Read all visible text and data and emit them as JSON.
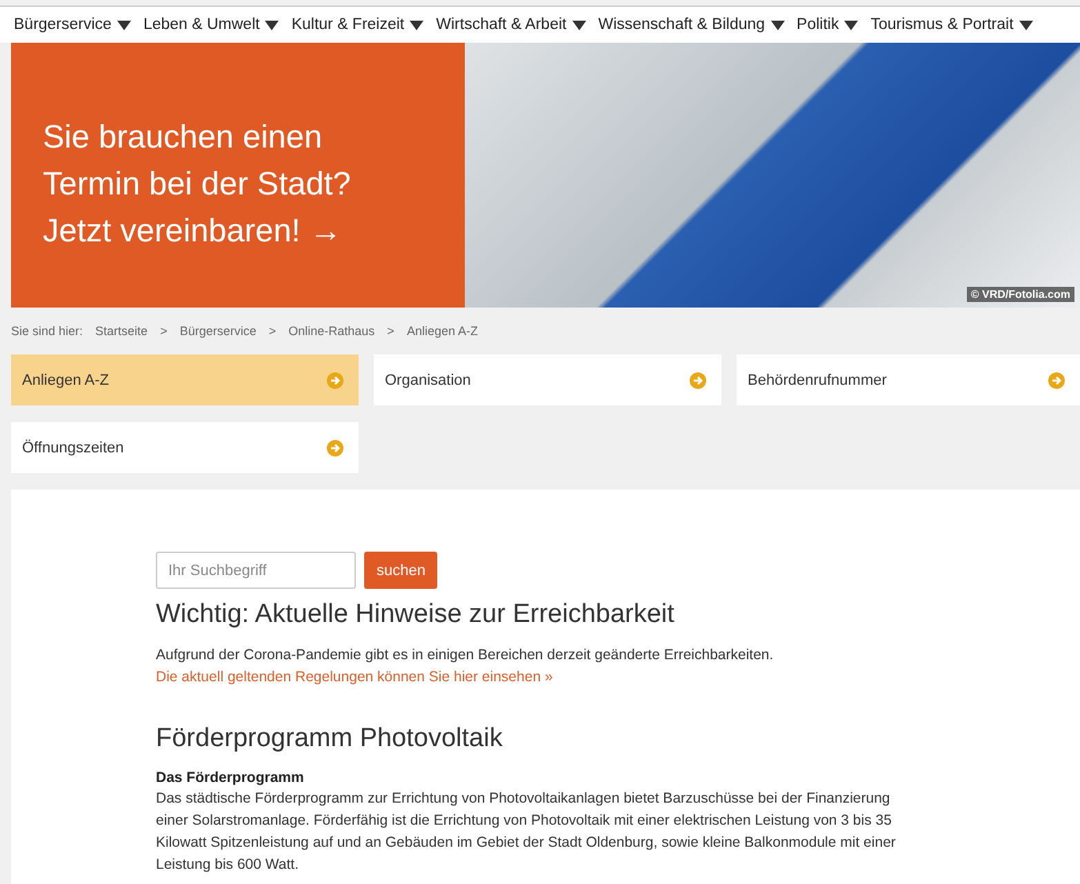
{
  "nav": {
    "items": [
      {
        "label": "Bürgerservice"
      },
      {
        "label": "Leben & Umwelt"
      },
      {
        "label": "Kultur & Freizeit"
      },
      {
        "label": "Wirtschaft & Arbeit"
      },
      {
        "label": "Wissenschaft & Bildung"
      },
      {
        "label": "Politik"
      },
      {
        "label": "Tourismus & Portrait"
      }
    ]
  },
  "hero": {
    "lines": [
      "Sie brauchen einen",
      "Termin bei der Stadt?",
      "Jetzt vereinbaren! →"
    ],
    "credit": "© VRD/Fotolia.com"
  },
  "breadcrumb": {
    "label": "Sie sind hier:",
    "items": [
      "Startseite",
      "Bürgerservice",
      "Online-Rathaus",
      "Anliegen A-Z"
    ],
    "separators": [
      ">",
      ">",
      ">"
    ]
  },
  "tiles": [
    {
      "label": "Anliegen A-Z",
      "selected": true
    },
    {
      "label": "Organisation",
      "selected": false
    },
    {
      "label": "Behördenrufnummer",
      "selected": false
    },
    {
      "label": "Öffnungszeiten",
      "selected": false
    }
  ],
  "search": {
    "placeholder": "Ihr Suchbegriff",
    "button": "suchen"
  },
  "notice": {
    "title": "Wichtig: Aktuelle Hinweise zur Erreichbarkeit",
    "text": "Aufgrund der Corona-Pandemie gibt es in einigen Bereichen derzeit geänderte Erreichbarkeiten.",
    "link": "Die aktuell geltenden Regelungen können Sie hier einsehen »"
  },
  "article": {
    "title": "Förderprogramm Photovoltaik",
    "subtitle": "Das Förderprogramm",
    "text": "Das städtische Förderprogramm zur Errichtung von Photovoltaikanlagen bietet Barzuschüsse bei der Finanzierung einer Solarstromanlage. Förderfähig ist die Errichtung von Photovoltaik mit einer elektrischen Leistung von 3 bis 35 Kilowatt Spitzenleistung auf und an Gebäuden im Gebiet der Stadt Oldenburg, sowie kleine Balkonmodule mit einer Leistung bis 600 Watt."
  }
}
